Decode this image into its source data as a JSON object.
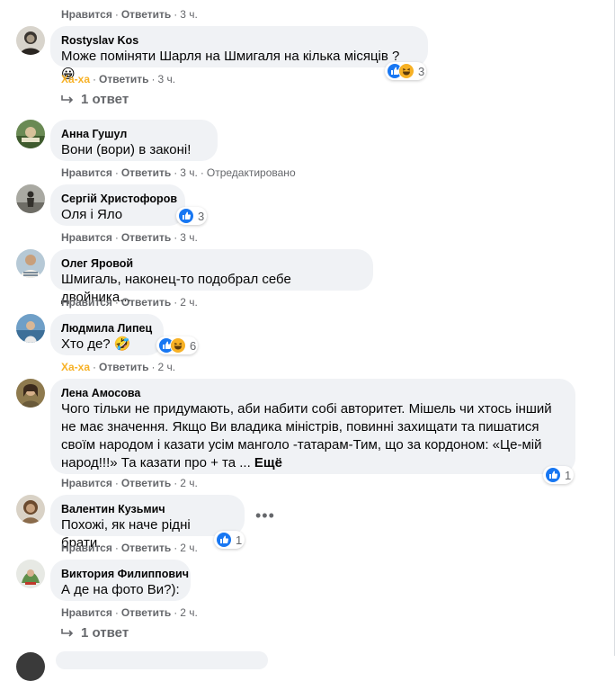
{
  "labels": {
    "like": "Нравится",
    "reply": "Ответить",
    "sep": "·",
    "more": "Ещё",
    "dots": "•••"
  },
  "top_actions": {
    "time": "3 ч."
  },
  "comments": [
    {
      "author": "Rostyslav Kos",
      "lines": [
        "Може поміняти Шарля на Шмигаля на кілька місяців ? 😀"
      ],
      "reaction_count": "3",
      "reaction_type": "Ха-ха",
      "time": "3 ч.",
      "replies": "1 ответ"
    },
    {
      "author": "Анна Гушул",
      "lines": [
        "Вони (вори) в законі!"
      ],
      "time": "3 ч.",
      "edited": "Отредактировано"
    },
    {
      "author": "Сергій Христофоров",
      "lines": [
        "Оля і Яло"
      ],
      "reaction_count": "3",
      "time": "3 ч."
    },
    {
      "author": "Олег Яровой",
      "lines": [
        "Шмигаль, наконец-то подобрал себе двойника..."
      ],
      "time": "2 ч."
    },
    {
      "author": "Людмила Липец",
      "lines": [
        "Хто де? 🤣"
      ],
      "reaction_count": "6",
      "reaction_type": "Ха-ха",
      "time": "2 ч."
    },
    {
      "author": "Лена Амосова",
      "lines": [
        "Чого тільки не придумають, аби набити собі авторитет. Мішель чи хтось інший",
        "не має значення. Якщо Ви владика міністрів, повинні захищати та пишатися",
        "своїм народом і казати усім манголо -татарам-Тим, що за кордоном: «Це-мій",
        "народ!!!» Та казати про + та ..."
      ],
      "reaction_count": "1",
      "time": "2 ч."
    },
    {
      "author": "Валентин Кузьмич",
      "lines": [
        "Похожі, як наче рідні брати."
      ],
      "reaction_count": "1",
      "time": "2 ч."
    },
    {
      "author": "Виктория Филиппович",
      "lines": [
        "А де на фото Ви?):"
      ],
      "time": "2 ч.",
      "replies": "1 ответ"
    }
  ],
  "colors": {
    "like_blue": "#1877f2",
    "haha_yellow": "#f7b125",
    "bubble": "#f0f2f5",
    "meta_gray": "#65676b"
  }
}
